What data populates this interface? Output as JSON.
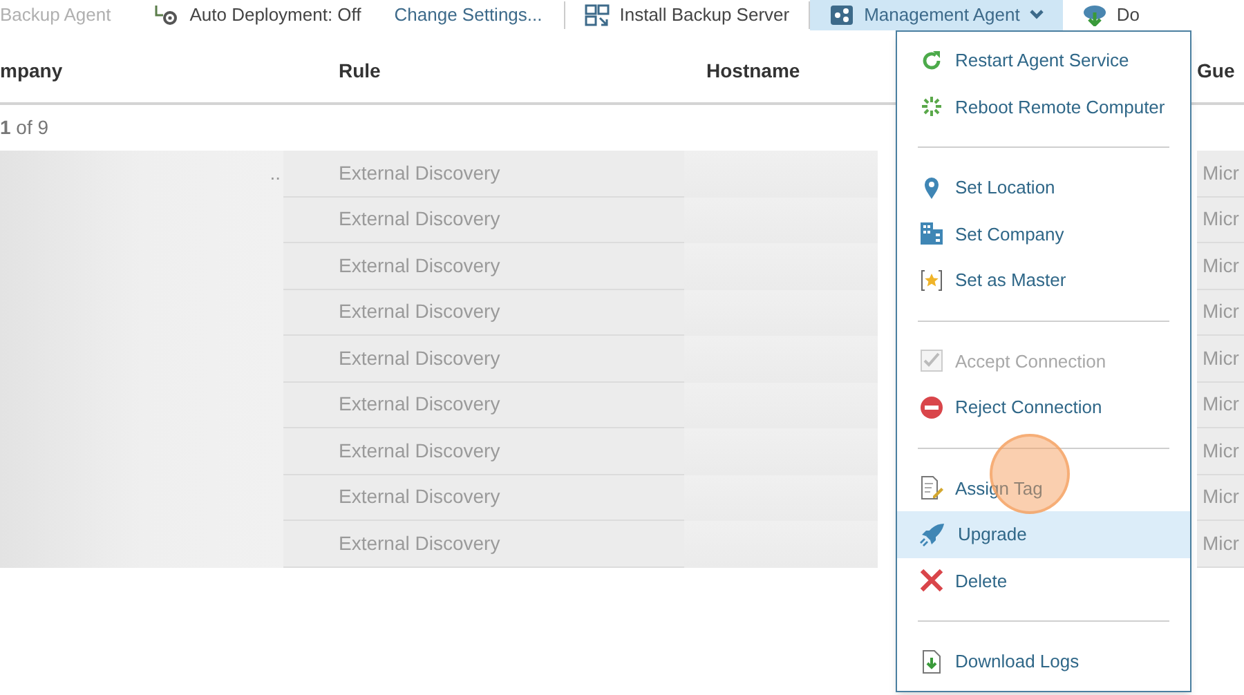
{
  "toolbar": [
    {
      "kind": "disabled",
      "label": "Backup Agent"
    },
    {
      "kind": "icon",
      "label": "Auto Deployment: Off"
    },
    {
      "kind": "link",
      "label": "Change Settings..."
    },
    {
      "kind": "divider"
    },
    {
      "kind": "icon",
      "label": "Install Backup Server"
    },
    {
      "kind": "divider"
    },
    {
      "kind": "menu",
      "label": "Management Agent",
      "expanded": true
    },
    {
      "kind": "icon",
      "label": "Do"
    }
  ],
  "table": {
    "columns": [
      "mpany",
      "Rule",
      "Hostname",
      "",
      "Gue"
    ],
    "pager": "**1** of 9",
    "rows": [
      {
        "company": "..",
        "rule": "External Discovery",
        "guest": "Micr"
      },
      {
        "rule": "External Discovery",
        "guest": "Micr"
      },
      {
        "rule": "External Discovery",
        "guest": "Micr"
      },
      {
        "rule": "External Discovery",
        "guest": "Micr"
      },
      {
        "rule": "External Discovery",
        "guest": "Micr"
      },
      {
        "rule": "External Discovery",
        "guest": "Micr"
      },
      {
        "rule": "External Discovery",
        "guest": "Micr"
      },
      {
        "rule": "External Discovery",
        "guest": "Micr"
      },
      {
        "rule": "External Discovery",
        "guest": "Micr"
      }
    ]
  },
  "menu": [
    {
      "kind": "item",
      "label": "Restart Agent Service",
      "disabled": false,
      "selected": false
    },
    {
      "kind": "item",
      "label": "Reboot Remote Computer",
      "disabled": false,
      "selected": false
    },
    {
      "kind": "separator"
    },
    {
      "kind": "item",
      "label": "Set Location",
      "disabled": false,
      "selected": false
    },
    {
      "kind": "item",
      "label": "Set Company",
      "disabled": false,
      "selected": false
    },
    {
      "kind": "item",
      "label": "Set as Master",
      "disabled": false,
      "selected": false
    },
    {
      "kind": "separator"
    },
    {
      "kind": "item",
      "label": "Accept Connection",
      "disabled": true,
      "selected": false
    },
    {
      "kind": "item",
      "label": "Reject Connection",
      "disabled": false,
      "selected": false
    },
    {
      "kind": "separator"
    },
    {
      "kind": "item",
      "label": "Assign Tag",
      "disabled": false,
      "selected": false
    },
    {
      "kind": "item",
      "label": "Upgrade",
      "disabled": false,
      "selected": true
    },
    {
      "kind": "item",
      "label": "Delete",
      "disabled": false,
      "selected": false
    },
    {
      "kind": "separator"
    },
    {
      "kind": "item",
      "label": "Download Logs",
      "disabled": false,
      "selected": false
    }
  ],
  "click_indicator": {
    "visible": true
  }
}
